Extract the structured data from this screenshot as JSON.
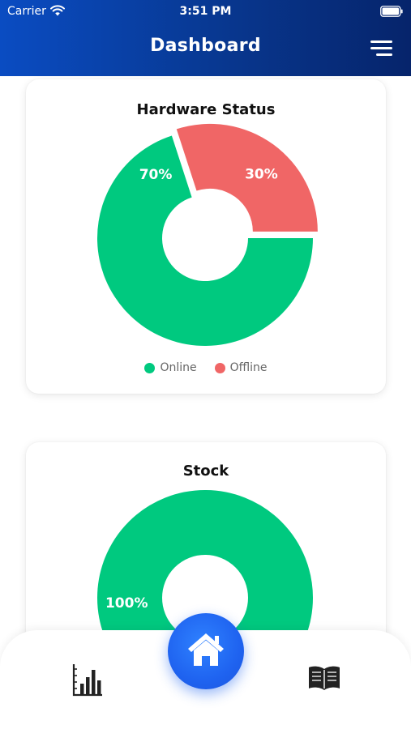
{
  "status_bar": {
    "carrier": "Carrier",
    "time": "3:51 PM"
  },
  "header": {
    "title": "Dashboard",
    "menu_icon": "hamburger-menu-icon"
  },
  "colors": {
    "online": "#00c97f",
    "offline": "#f06666",
    "header_start": "#0a4cc2",
    "header_end": "#06246b",
    "home_button": "#1f63f0"
  },
  "cards": [
    {
      "title": "Hardware Status",
      "legend": [
        {
          "label": "Online",
          "color": "#00c97f"
        },
        {
          "label": "Offline",
          "color": "#f06666"
        }
      ]
    },
    {
      "title": "Stock"
    }
  ],
  "chart_data": [
    {
      "type": "pie",
      "title": "Hardware Status",
      "categories": [
        "Online",
        "Offline"
      ],
      "values": [
        70,
        30
      ],
      "labels": [
        "70%",
        "30%"
      ],
      "colors": [
        "#00c97f",
        "#f06666"
      ],
      "legend": "bottom"
    },
    {
      "type": "pie",
      "title": "Stock",
      "categories": [],
      "values": [
        100
      ],
      "labels": [
        "100%"
      ],
      "colors": [
        "#00c97f"
      ]
    }
  ],
  "tab_bar": {
    "left_icon": "bar-chart-icon",
    "center_icon": "home-icon",
    "right_icon": "book-icon"
  }
}
